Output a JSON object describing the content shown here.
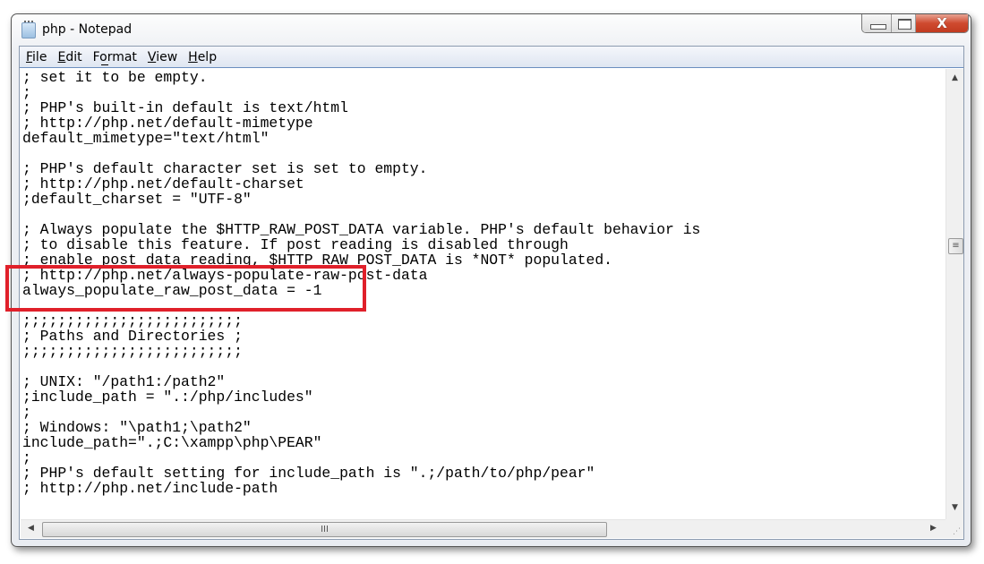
{
  "window": {
    "title": "php - Notepad",
    "icon": "notepad-icon",
    "controls": {
      "minimize": "minimize-icon",
      "maximize": "maximize-icon",
      "close": "X"
    }
  },
  "menu": [
    {
      "label": "File",
      "accel": "F",
      "rest": "ile"
    },
    {
      "label": "Edit",
      "accel": "E",
      "rest": "dit"
    },
    {
      "label": "Format",
      "pre": "F",
      "accel": "o",
      "rest": "rmat"
    },
    {
      "label": "View",
      "accel": "V",
      "rest": "iew"
    },
    {
      "label": "Help",
      "accel": "H",
      "rest": "elp"
    }
  ],
  "lines": [
    "; set it to be empty.",
    ";",
    "; PHP's built-in default is text/html",
    "; http://php.net/default-mimetype",
    "default_mimetype=\"text/html\"",
    "",
    "; PHP's default character set is set to empty.",
    "; http://php.net/default-charset",
    ";default_charset = \"UTF-8\"",
    "",
    "; Always populate the $HTTP_RAW_POST_DATA variable. PHP's default behavior is",
    "; to disable this feature. If post reading is disabled through",
    "; enable_post_data_reading, $HTTP_RAW_POST_DATA is *NOT* populated.",
    "; http://php.net/always-populate-raw-post-data",
    "always_populate_raw_post_data = -1",
    "",
    ";;;;;;;;;;;;;;;;;;;;;;;;;",
    "; Paths and Directories ;",
    ";;;;;;;;;;;;;;;;;;;;;;;;;",
    "",
    "; UNIX: \"/path1:/path2\"",
    ";include_path = \".:/php/includes\"",
    ";",
    "; Windows: \"\\path1;\\path2\"",
    "include_path=\".;C:\\xampp\\php\\PEAR\"",
    ";",
    "; PHP's default setting for include_path is \".;/path/to/php/pear\"",
    "; http://php.net/include-path"
  ],
  "highlight_color": "#e0202a"
}
